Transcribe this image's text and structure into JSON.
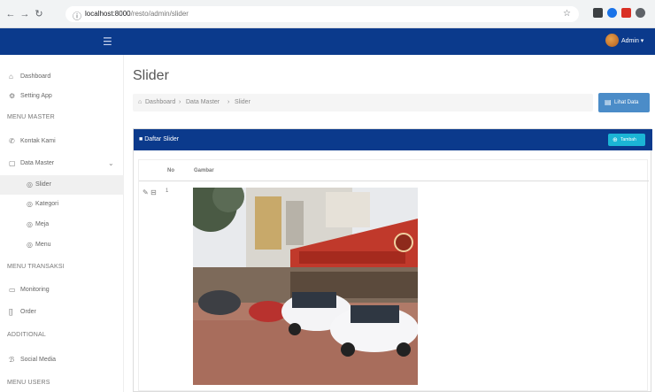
{
  "browser": {
    "url_host": "localhost:8000",
    "url_path": "/resto/admin/slider",
    "back_icon": "arrow-left-icon",
    "forward_icon": "arrow-right-icon",
    "reload_icon": "reload-icon",
    "site_info_icon": "info-icon",
    "star_icon": "star-icon"
  },
  "header": {
    "menu_icon": "hamburger-icon",
    "user_label": "Admin ▾"
  },
  "sidebar": {
    "items": [
      {
        "icon": "home-icon",
        "glyph": "⌂",
        "label": "Dashboard"
      },
      {
        "icon": "settings-icon",
        "glyph": "⚙",
        "label": "Setting App"
      }
    ],
    "section_master": "MENU MASTER",
    "master_items": [
      {
        "icon": "phone-icon",
        "glyph": "✆",
        "label": "Kontak Kami"
      },
      {
        "icon": "folder-icon",
        "glyph": "▢",
        "label": "Data Master"
      }
    ],
    "sub_items": [
      {
        "icon": "circle-icon",
        "glyph": "◎",
        "label": "Slider"
      },
      {
        "icon": "circle-icon",
        "glyph": "◎",
        "label": "Kategori"
      },
      {
        "icon": "circle-icon",
        "glyph": "◎",
        "label": "Meja"
      },
      {
        "icon": "circle-icon",
        "glyph": "◎",
        "label": "Menu"
      }
    ],
    "section_transaksi": "MENU TRANSAKSI",
    "transaksi_items": [
      {
        "icon": "monitor-icon",
        "glyph": "▭",
        "label": "Monitoring"
      },
      {
        "icon": "order-icon",
        "glyph": "[]",
        "label": "Order"
      }
    ],
    "section_additional": "ADDITIONAL",
    "additional_items": [
      {
        "icon": "social-icon",
        "glyph": "ℬ",
        "label": "Social Media"
      }
    ],
    "section_users": "MENU USERS"
  },
  "content": {
    "title": "Slider",
    "breadcrumb": [
      "Dashboard",
      "Data Master",
      "Slider"
    ],
    "breadcrumb_sep": "›",
    "view_button": "Lihat Data",
    "card_title": "Daftar Slider",
    "add_button": "Tambah",
    "table": {
      "headers": [
        "No",
        "Gambar"
      ],
      "rows": [
        {
          "no": "1",
          "image_alt": "restaurant-storefront-photo"
        }
      ]
    }
  },
  "colors": {
    "brand_blue": "#0b3a8c",
    "info_cyan": "#1bb5d5",
    "button_blue": "#4b8cc8"
  }
}
